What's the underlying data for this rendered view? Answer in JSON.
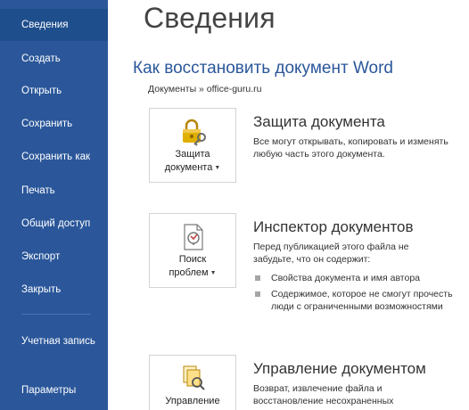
{
  "sidebar": {
    "items": [
      {
        "label": "Сведения",
        "active": true
      },
      {
        "label": "Создать"
      },
      {
        "label": "Открыть"
      },
      {
        "label": "Сохранить"
      },
      {
        "label": "Сохранить как"
      },
      {
        "label": "Печать"
      },
      {
        "label": "Общий доступ"
      },
      {
        "label": "Экспорт"
      },
      {
        "label": "Закрыть"
      },
      {
        "label": "Учетная запись"
      },
      {
        "label": "Параметры"
      }
    ]
  },
  "main": {
    "page_title": "Сведения",
    "doc_title": "Как восстановить документ Word",
    "breadcrumb": "Документы » office-guru.ru",
    "sections": [
      {
        "button_line1": "Защита",
        "button_line2": "документа",
        "icon": "lock-key-icon",
        "title": "Защита документа",
        "description": "Все могут открывать, копировать и изменять любую часть этого документа."
      },
      {
        "button_line1": "Поиск",
        "button_line2": "проблем",
        "icon": "inspect-document-icon",
        "title": "Инспектор документов",
        "description": "Перед публикацией этого файла не забудьте, что он содержит:",
        "bullets": [
          "Свойства документа и имя автора",
          "Содержимое, которое не смогут прочесть люди с ограниченными возможностями"
        ]
      },
      {
        "button_line1": "Управление",
        "icon": "manage-document-icon",
        "title": "Управление документом",
        "description": "Возврат, извлечение файла и восстановление несохраненных"
      }
    ]
  },
  "colors": {
    "sidebar_bg": "#2b579a",
    "active_item_bg": "#1e4e8c",
    "accent": "#2b579a"
  }
}
